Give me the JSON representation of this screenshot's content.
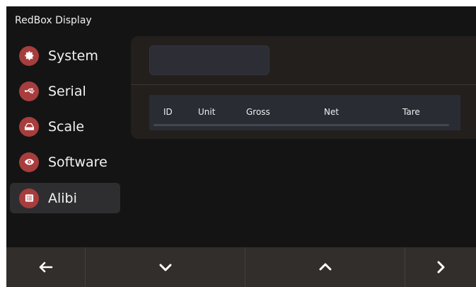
{
  "app": {
    "title": "RedBox Display"
  },
  "sidebar": {
    "items": [
      {
        "label": "System",
        "icon": "gear-icon",
        "active": false
      },
      {
        "label": "Serial",
        "icon": "usb-icon",
        "active": false
      },
      {
        "label": "Scale",
        "icon": "scale-icon",
        "active": false
      },
      {
        "label": "Software",
        "icon": "eye-icon",
        "active": false
      },
      {
        "label": "Alibi",
        "icon": "list-icon",
        "active": true
      }
    ]
  },
  "main": {
    "search": {
      "value": "",
      "placeholder": ""
    },
    "table": {
      "columns": [
        "ID",
        "Unit",
        "Gross",
        "Net",
        "Tare"
      ],
      "rows": []
    }
  },
  "footer": {
    "buttons": [
      {
        "icon": "arrow-left-icon"
      },
      {
        "icon": "chevron-down-icon"
      },
      {
        "icon": "chevron-up-icon"
      },
      {
        "icon": "chevron-right-icon"
      }
    ]
  },
  "colors": {
    "background": "#141414",
    "accent": "#a73d3d",
    "panel": "#231f1d",
    "footer": "#322e2c",
    "active_item": "#2e2e30"
  }
}
